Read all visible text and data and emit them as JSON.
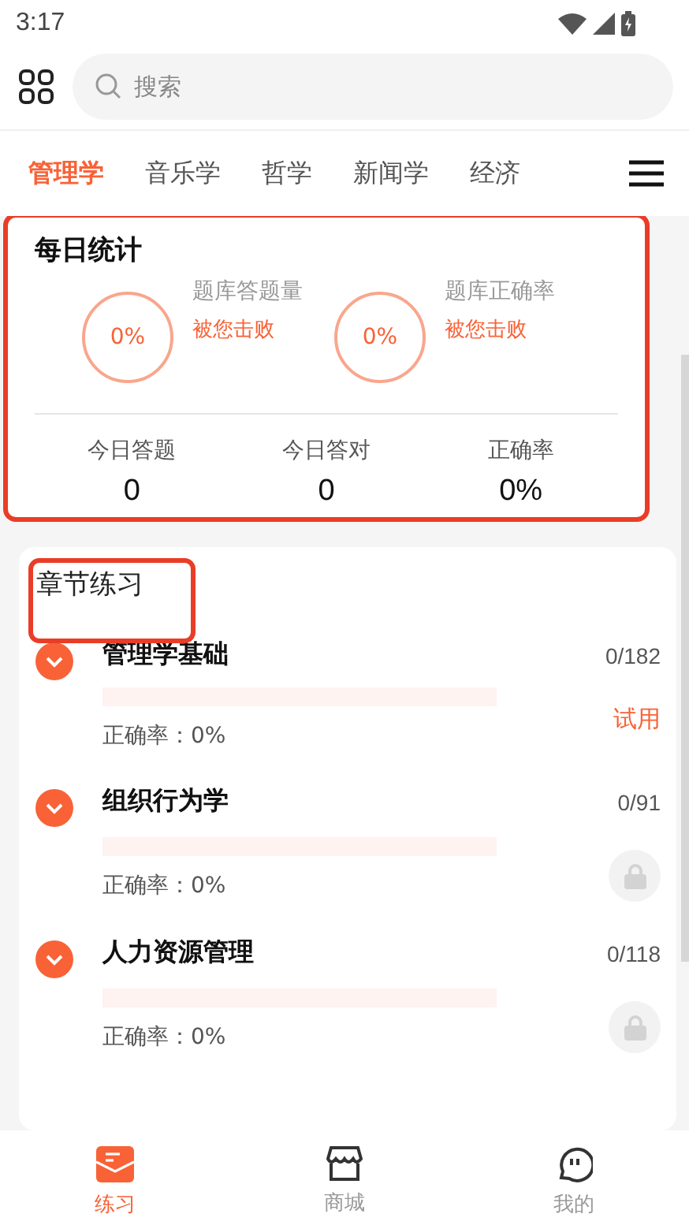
{
  "status_bar": {
    "time": "3:17"
  },
  "search": {
    "placeholder": "搜索"
  },
  "tabs": [
    {
      "label": "管理学",
      "selected": true
    },
    {
      "label": "音乐学",
      "selected": false
    },
    {
      "label": "哲学",
      "selected": false
    },
    {
      "label": "新闻学",
      "selected": false
    },
    {
      "label": "经济",
      "selected": false
    }
  ],
  "daily_stats": {
    "title": "每日统计",
    "highlighted": true,
    "rings": [
      {
        "value": "0%",
        "label": "题库答题量",
        "note": "被您击败"
      },
      {
        "value": "0%",
        "label": "题库正确率",
        "note": "被您击败"
      }
    ],
    "totals": [
      {
        "label": "今日答题",
        "value": "0"
      },
      {
        "label": "今日答对",
        "value": "0"
      },
      {
        "label": "正确率",
        "value": "0%"
      }
    ]
  },
  "chapters": {
    "title": "章节练习",
    "highlighted": true,
    "items": [
      {
        "name": "管理学基础",
        "count": "0/182",
        "level": 0,
        "accuracy": "正确率：0%",
        "kind": "trial",
        "action": "试用"
      },
      {
        "name": "组织行为学",
        "count": "0/91",
        "level": 0,
        "accuracy": "正确率：0%",
        "kind": "locked"
      },
      {
        "name": "人力资源管理",
        "count": "0/118",
        "level": 0,
        "accuracy": "正确率：0%",
        "kind": "locked"
      }
    ]
  },
  "bottom_nav": [
    {
      "label": "练习",
      "selected": true,
      "kind": "practice"
    },
    {
      "label": "商城",
      "selected": false,
      "kind": "shop"
    },
    {
      "label": "我的",
      "selected": false,
      "kind": "me"
    }
  ]
}
